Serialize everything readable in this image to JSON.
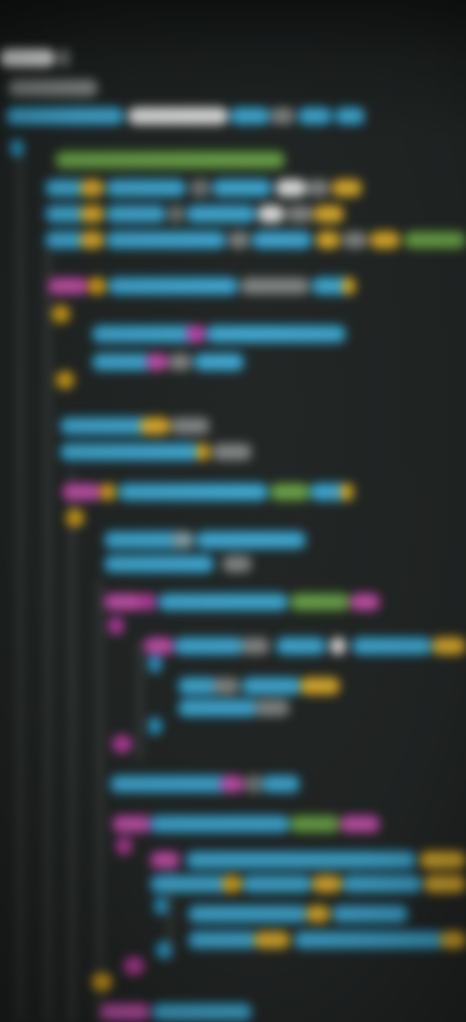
{
  "colors": {
    "background": "#232726",
    "keyword_blue": "#2aa6d8",
    "string_yellow": "#e0a816",
    "keyword_magenta": "#c23fa6",
    "comment_green": "#5c9c35",
    "text_white": "#e6e6e6",
    "gray": "#8a8f8c"
  },
  "icons": [
    "indent-guide"
  ],
  "scene": {
    "description": ""
  }
}
